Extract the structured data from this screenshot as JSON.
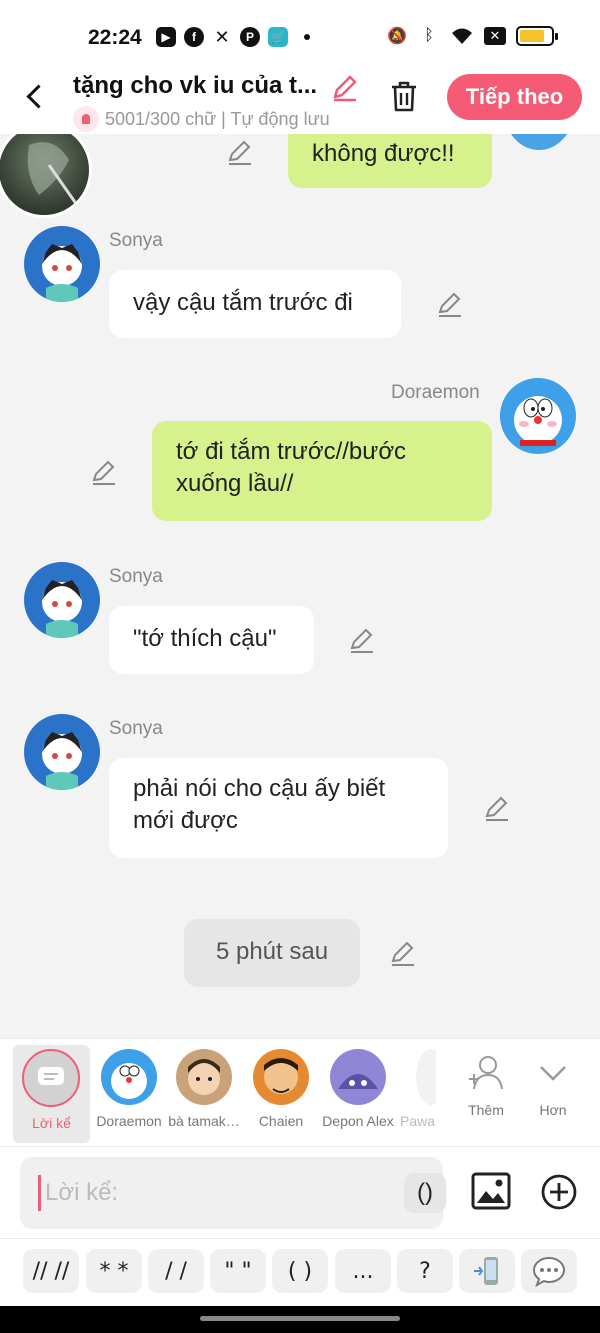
{
  "status": {
    "time": "22:24",
    "apps": [
      "video-app-icon",
      "facebook-icon",
      "tools-icon",
      "pinterest-icon",
      "shopping-cart-icon"
    ]
  },
  "header": {
    "title": "tặng cho vk iu của t...",
    "subtitle": "5001/300 chữ | Tự động lưu",
    "next_label": "Tiếp theo"
  },
  "chat": {
    "messages": [
      {
        "speaker": "",
        "text": "không được!!",
        "side": "right"
      },
      {
        "speaker": "Sonya",
        "text": "vậy cậu tắm trước đi",
        "side": "left"
      },
      {
        "speaker": "Doraemon",
        "text": "tớ đi tắm trước//bước xuống lầu//",
        "side": "right"
      },
      {
        "speaker": "Sonya",
        "text": "\"tớ thích cậu\"",
        "side": "left"
      },
      {
        "speaker": "Sonya",
        "text": "phải nói cho cậu ấy biết mới được",
        "side": "left"
      },
      {
        "speaker": "",
        "text": "5 phút sau",
        "side": "narration"
      }
    ]
  },
  "characters": {
    "narrator_label": "Lời kể",
    "items": [
      {
        "label": "Doraemon"
      },
      {
        "label": "bà tamak…"
      },
      {
        "label": "Chaien"
      },
      {
        "label": "Depon Alex"
      },
      {
        "label": "Pawa"
      }
    ],
    "add_label": "Thêm",
    "more_label": "Hơn"
  },
  "input": {
    "placeholder": "Lời kể:",
    "paren_label": "()"
  },
  "quick_formats": [
    "// //",
    "* *",
    "/ /",
    "\" \"",
    "( )",
    "...",
    "?"
  ],
  "colors": {
    "accent": "#f55b75",
    "green_bubble": "#d7f18d",
    "bg": "#f3f3f3"
  }
}
